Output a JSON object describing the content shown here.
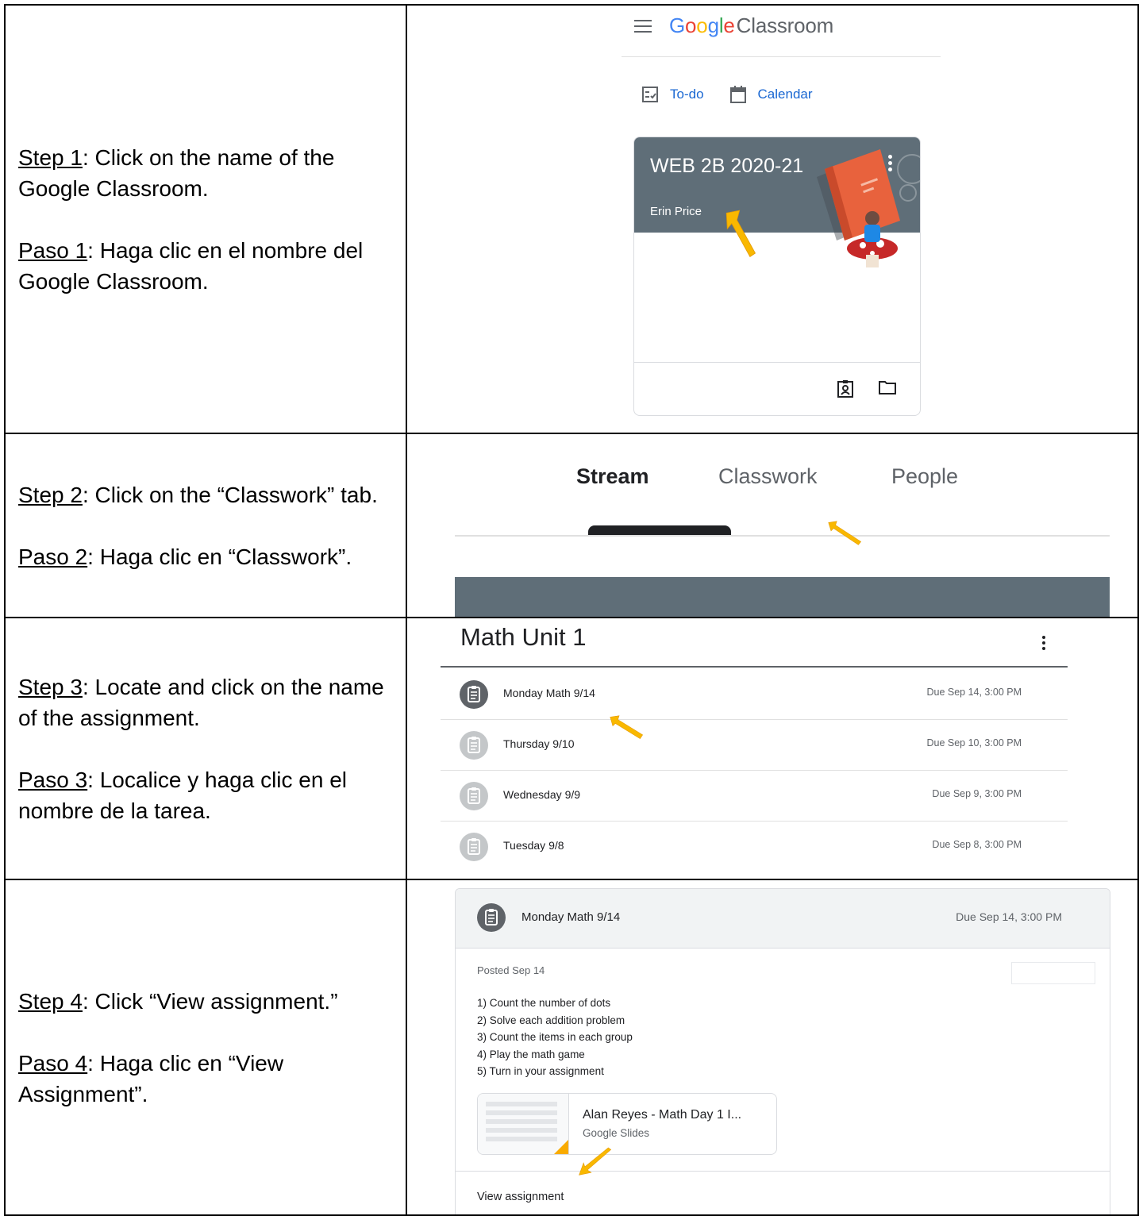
{
  "steps": [
    {
      "en_label": "Step 1",
      "en_text": ": Click on the name of the Google Classroom.",
      "es_label": "Paso 1",
      "es_text": ": Haga clic en el nombre del Google Classroom."
    },
    {
      "en_label": "Step 2",
      "en_text": ": Click on the “Classwork” tab.",
      "es_label": "Paso 2",
      "es_text": ": Haga clic en “Classwork”."
    },
    {
      "en_label": "Step 3",
      "en_text": ": Locate and click on the name of the assignment.",
      "es_label": "Paso 3",
      "es_text": ": Localice y haga clic en el nombre de la tarea."
    },
    {
      "en_label": "Step 4",
      "en_text": ": Click “View assignment.”",
      "es_label": "Paso 4",
      "es_text": ": Haga clic en “View Assignment”."
    }
  ],
  "classroom_home": {
    "logo_google": [
      "G",
      "o",
      "o",
      "g",
      "l",
      "e"
    ],
    "logo_product": "Classroom",
    "todo_label": "To-do",
    "calendar_label": "Calendar",
    "card": {
      "title": "WEB 2B 2020-21",
      "teacher": "Erin Price"
    }
  },
  "class_tabs": {
    "stream": "Stream",
    "classwork": "Classwork",
    "people": "People"
  },
  "topic": {
    "title": "Math Unit 1",
    "assignments": [
      {
        "name": "Monday Math 9/14",
        "due": "Due Sep 14, 3:00 PM",
        "active": true
      },
      {
        "name": "Thursday 9/10",
        "due": "Due Sep 10, 3:00 PM",
        "active": false
      },
      {
        "name": "Wednesday 9/9",
        "due": "Due Sep 9, 3:00 PM",
        "active": false
      },
      {
        "name": "Tuesday 9/8",
        "due": "Due Sep 8, 3:00 PM",
        "active": false
      }
    ]
  },
  "assignment_detail": {
    "name": "Monday Math 9/14",
    "due": "Due Sep 14, 3:00 PM",
    "posted": "Posted Sep 14",
    "instructions": [
      "1) Count the number of dots",
      "2) Solve each addition problem",
      "3) Count the items in each group",
      "4) Play the math game",
      "5) Turn in your assignment"
    ],
    "attachment_title": "Alan Reyes - Math Day 1 I...",
    "attachment_type": "Google Slides",
    "view_label": "View assignment"
  },
  "colors": {
    "banner": "#5f6e78",
    "link_blue": "#1967d2",
    "arrow_yellow": "#f9b800",
    "icon_dark": "#5f6368",
    "icon_light": "#c4c7c9"
  }
}
